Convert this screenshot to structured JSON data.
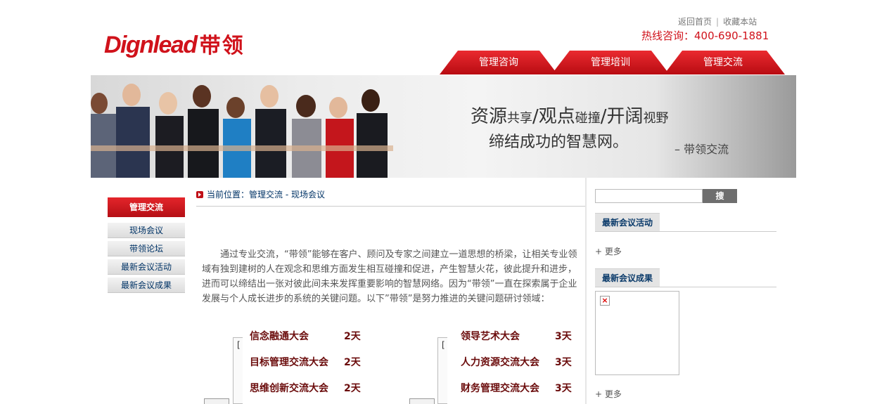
{
  "header": {
    "logo_en": "Dignlead",
    "logo_cn": "带领",
    "links": [
      "返回首页",
      "收藏本站"
    ],
    "link_sep": "|",
    "hotline": "热线咨询：400-690-1881"
  },
  "nav": {
    "tabs": [
      {
        "label": "管理咨询"
      },
      {
        "label": "管理培训"
      },
      {
        "label": "管理交流"
      }
    ],
    "color": "#d0121b"
  },
  "banner": {
    "slogan_big1": "资源",
    "slogan_small1": "共享",
    "slogan_big2": "/观点",
    "slogan_small2": "碰撞",
    "slogan_big3": "/开阔",
    "slogan_small3": "视野",
    "slogan_line2": "缔结成功的智慧网。",
    "signature": "– 带领交流"
  },
  "sidebar": {
    "heading": "管理交流",
    "items": [
      {
        "label": "现场会议"
      },
      {
        "label": "带领论坛"
      },
      {
        "label": "最新会议活动"
      },
      {
        "label": "最新会议成果"
      }
    ]
  },
  "main": {
    "breadcrumb": "当前位置：管理交流  - 现场会议",
    "intro": "通过专业交流，“带领”能够在客户、顾问及专家之间建立一道思想的桥梁，让相关专业领域有独到建树的人在观念和思维方面发生相互碰撞和促进，产生智慧火花，彼此提升和进步，进而可以缔结出一张对彼此间未来发挥重要影响的智慧网络。因为“带领”一直在探索属于企业发展与个人成长进步的系统的关键问题。以下”带领”是努力推进的关键问题研讨领域：",
    "topics_left": [
      {
        "name": "信念融通大会",
        "days": "2天"
      },
      {
        "name": "目标管理交流大会",
        "days": "2天"
      },
      {
        "name": "思维创新交流大会",
        "days": "2天"
      }
    ],
    "topics_right": [
      {
        "name": "领导艺术大会",
        "days": "3天"
      },
      {
        "name": "人力资源交流大会",
        "days": "3天"
      },
      {
        "name": "财务管理交流大会",
        "days": "3天"
      }
    ],
    "bracket_mark": "["
  },
  "right": {
    "search_placeholder": "",
    "search_button": "搜 索",
    "section1_title": "最新会议活动",
    "section1_more": "+ 更多",
    "section2_title": "最新会议成果",
    "section2_more": "+ 更多",
    "broken_image_glyph": "×"
  },
  "colors": {
    "brand_red": "#d0121b",
    "link_blue": "#003366",
    "topic_dark_red": "#6b0c0c"
  }
}
